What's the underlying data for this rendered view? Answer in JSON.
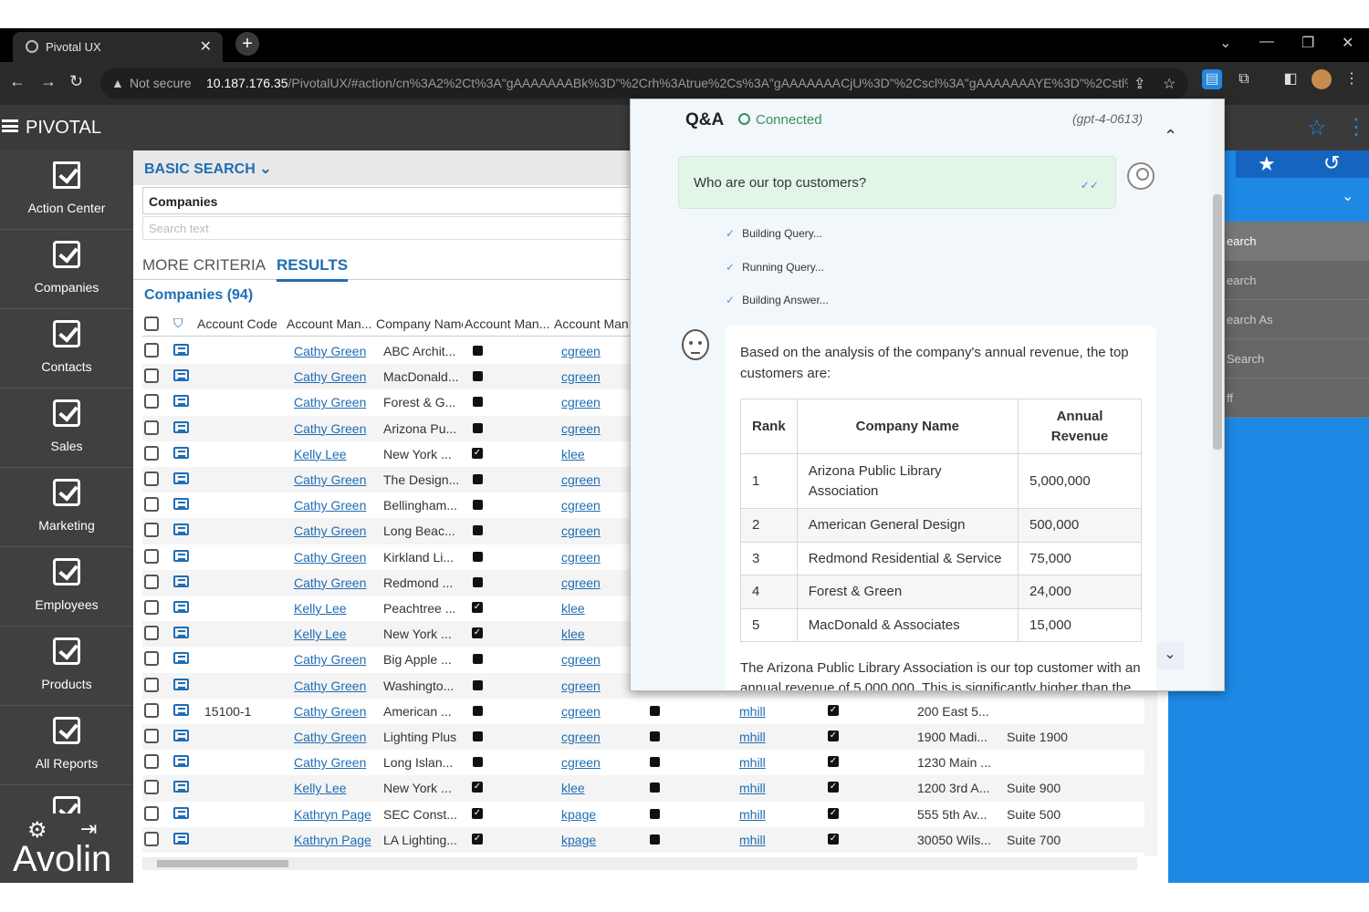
{
  "browser": {
    "tab_title": "Pivotal UX",
    "not_secure": "Not secure",
    "url_host": "10.187.176.35",
    "url_path": "/PivotalUX/#action/cn%3A2%2Ct%3A\"gAAAAAAABk%3D\"%2Crh%3Atrue%2Cs%3A\"gAAAAAAACjU%3D\"%2Cscl%3A\"gAAAAAAAYE%3D\"%2Cstl%3A..."
  },
  "app": {
    "brand": "PIVOTAL"
  },
  "sidebar": {
    "items": [
      {
        "label": "Action Center"
      },
      {
        "label": "Companies"
      },
      {
        "label": "Contacts"
      },
      {
        "label": "Sales"
      },
      {
        "label": "Marketing"
      },
      {
        "label": "Employees"
      },
      {
        "label": "Products"
      },
      {
        "label": "All Reports"
      }
    ],
    "footer_logo": "Avolin"
  },
  "search": {
    "title": "BASIC SEARCH",
    "type_value": "Companies",
    "text_placeholder": "Search text"
  },
  "tabs": {
    "more": "MORE CRITERIA",
    "results": "RESULTS"
  },
  "results": {
    "count_label": "Companies (94)",
    "columns": [
      "Account Code",
      "Account Man...",
      "Company Name",
      "Account Man...",
      "Account Man..."
    ],
    "rows": [
      {
        "code": "",
        "manager": "Cathy Green",
        "company": "ABC Archit...",
        "checked": false,
        "login": "cgreen",
        "extra": null
      },
      {
        "code": "",
        "manager": "Cathy Green",
        "company": "MacDonald...",
        "checked": false,
        "login": "cgreen",
        "extra": null
      },
      {
        "code": "",
        "manager": "Cathy Green",
        "company": "Forest & G...",
        "checked": false,
        "login": "cgreen",
        "extra": null
      },
      {
        "code": "",
        "manager": "Cathy Green",
        "company": "Arizona Pu...",
        "checked": false,
        "login": "cgreen",
        "extra": null
      },
      {
        "code": "",
        "manager": "Kelly Lee",
        "company": "New York ...",
        "checked": true,
        "login": "klee",
        "extra": null
      },
      {
        "code": "",
        "manager": "Cathy Green",
        "company": "The Design...",
        "checked": false,
        "login": "cgreen",
        "extra": null
      },
      {
        "code": "",
        "manager": "Cathy Green",
        "company": "Bellingham...",
        "checked": false,
        "login": "cgreen",
        "extra": null
      },
      {
        "code": "",
        "manager": "Cathy Green",
        "company": "Long Beac...",
        "checked": false,
        "login": "cgreen",
        "extra": null
      },
      {
        "code": "",
        "manager": "Cathy Green",
        "company": "Kirkland Li...",
        "checked": false,
        "login": "cgreen",
        "extra": null
      },
      {
        "code": "",
        "manager": "Cathy Green",
        "company": "Redmond ...",
        "checked": false,
        "login": "cgreen",
        "extra": null
      },
      {
        "code": "",
        "manager": "Kelly Lee",
        "company": "Peachtree ...",
        "checked": true,
        "login": "klee",
        "extra": null
      },
      {
        "code": "",
        "manager": "Kelly Lee",
        "company": "New York ...",
        "checked": true,
        "login": "klee",
        "extra": null
      },
      {
        "code": "",
        "manager": "Cathy Green",
        "company": "Big Apple ...",
        "checked": false,
        "login": "cgreen",
        "extra": null
      },
      {
        "code": "",
        "manager": "Cathy Green",
        "company": "Washingto...",
        "checked": false,
        "login": "cgreen",
        "extra": null
      },
      {
        "code": "15100-1",
        "manager": "Cathy Green",
        "company": "American ...",
        "checked": false,
        "login": "cgreen",
        "extra": {
          "owner": "mhill",
          "address": "200 East 5...",
          "suite": ""
        }
      },
      {
        "code": "",
        "manager": "Cathy Green",
        "company": "Lighting Plus",
        "checked": false,
        "login": "cgreen",
        "extra": {
          "owner": "mhill",
          "address": "1900 Madi...",
          "suite": "Suite 1900"
        }
      },
      {
        "code": "",
        "manager": "Cathy Green",
        "company": "Long Islan...",
        "checked": false,
        "login": "cgreen",
        "extra": {
          "owner": "mhill",
          "address": "1230 Main ...",
          "suite": ""
        }
      },
      {
        "code": "",
        "manager": "Kelly Lee",
        "company": "New York ...",
        "checked": true,
        "login": "klee",
        "extra": {
          "owner": "mhill",
          "address": "1200 3rd A...",
          "suite": "Suite 900"
        }
      },
      {
        "code": "",
        "manager": "Kathryn Page",
        "company": "SEC Const...",
        "checked": true,
        "login": "kpage",
        "extra": {
          "owner": "mhill",
          "address": "555 5th Av...",
          "suite": "Suite 500"
        }
      },
      {
        "code": "",
        "manager": "Kathryn Page",
        "company": "LA Lighting...",
        "checked": true,
        "login": "kpage",
        "extra": {
          "owner": "mhill",
          "address": "30050 Wils...",
          "suite": "Suite 700"
        }
      }
    ]
  },
  "right_panel": {
    "items": [
      "earch",
      "earch",
      "earch As",
      "Search",
      "ff"
    ]
  },
  "qa": {
    "title": "Q&A",
    "status": "Connected",
    "model": "(gpt-4-0613)",
    "question": "Who are our top customers?",
    "steps": [
      "Building Query...",
      "Running Query...",
      "Building Answer..."
    ],
    "answer_intro": "Based on the analysis of the company's annual revenue, the top customers are:",
    "table_headers": [
      "Rank",
      "Company Name",
      "Annual Revenue"
    ],
    "table_rows": [
      {
        "rank": "1",
        "company": "Arizona Public Library Association",
        "revenue": "5,000,000"
      },
      {
        "rank": "2",
        "company": "American General Design",
        "revenue": "500,000"
      },
      {
        "rank": "3",
        "company": "Redmond Residential & Service",
        "revenue": "75,000"
      },
      {
        "rank": "4",
        "company": "Forest & Green",
        "revenue": "24,000"
      },
      {
        "rank": "5",
        "company": "MacDonald & Associates",
        "revenue": "15,000"
      }
    ],
    "answer_outro": "The Arizona Public Library Association is our top customer with an annual revenue of 5,000,000. This is significantly higher than the"
  }
}
